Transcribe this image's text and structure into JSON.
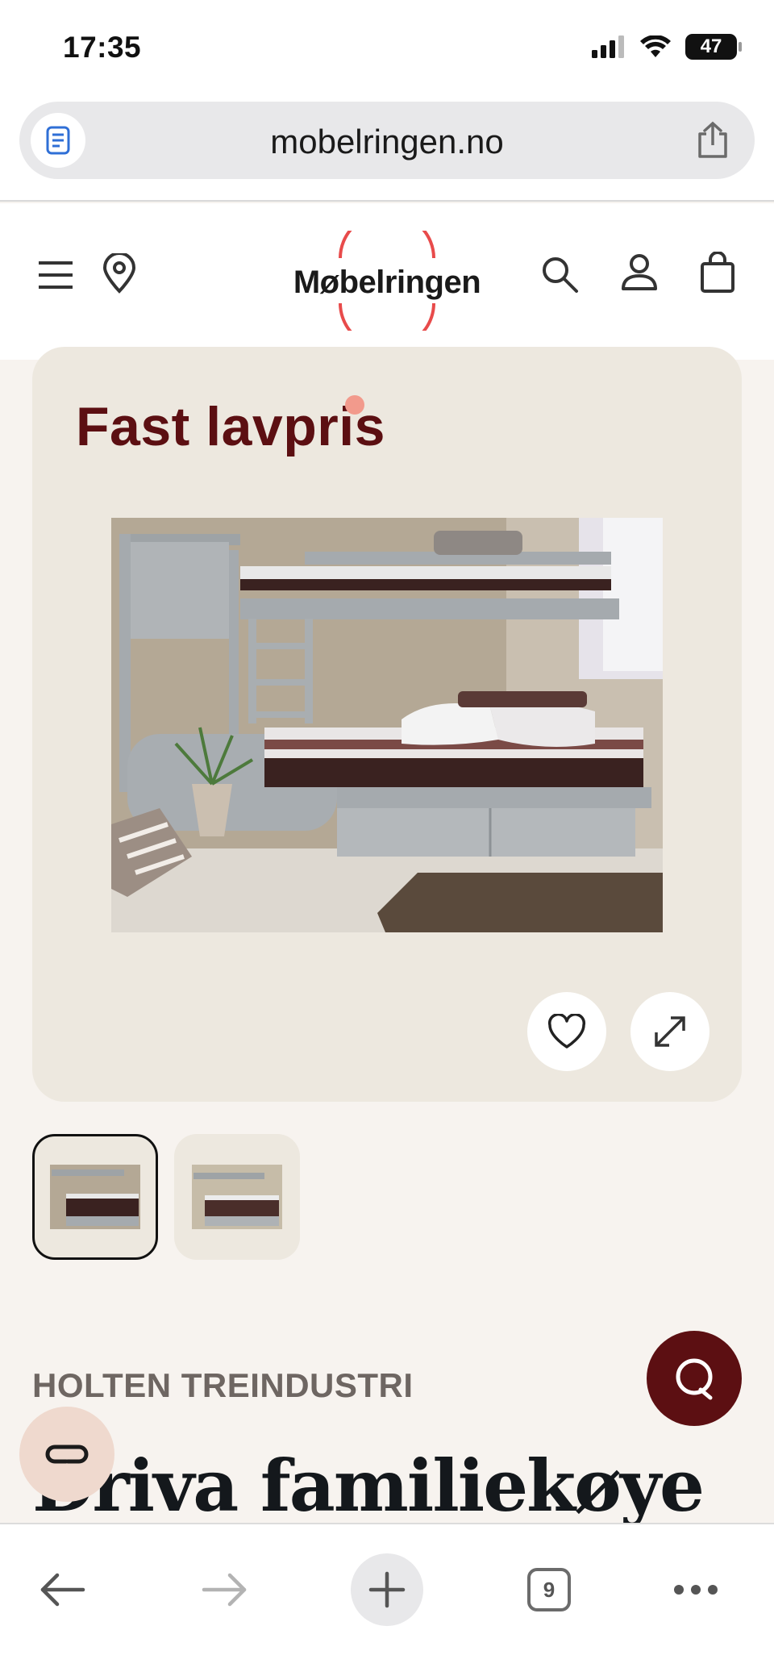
{
  "status_bar": {
    "time": "17:35",
    "battery": "47"
  },
  "browser": {
    "url": "mobelringen.no",
    "tabs_count": "9"
  },
  "header": {
    "logo_text": "Møbelringen",
    "brand_color": "#e84b4b"
  },
  "product": {
    "badge": "Fast lavpris",
    "badge_color": "#5c0f12",
    "brand": "HOLTEN TREINDUSTRI",
    "title": "Driva familiekøye",
    "thumbnail_count": 2
  },
  "icons": {
    "menu": "hamburger-icon",
    "store": "location-pin-icon",
    "search": "search-icon",
    "account": "user-icon",
    "cart": "shopping-bag-icon",
    "favorite": "heart-icon",
    "expand": "expand-icon",
    "chat": "chat-icon",
    "compare": "compare-icon"
  },
  "colors": {
    "accent": "#5c0f12",
    "card_bg": "#ede8df",
    "page_bg": "#f7f3ef"
  }
}
